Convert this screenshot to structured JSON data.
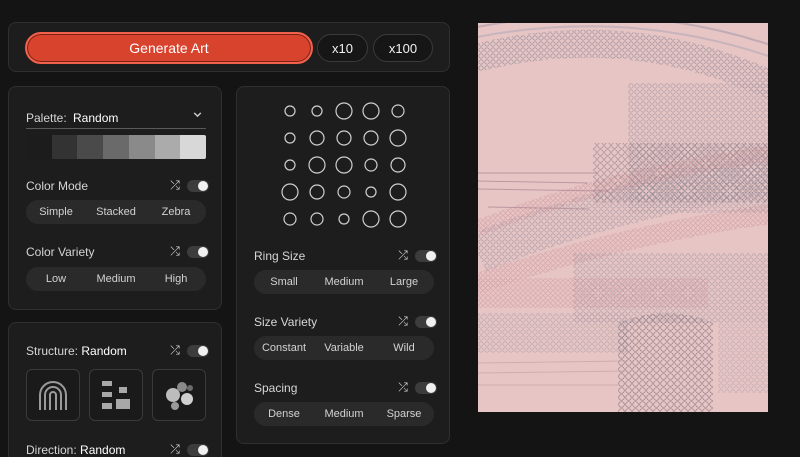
{
  "top_bar": {
    "generate_label": "Generate Art",
    "x10_label": "x10",
    "x100_label": "x100"
  },
  "color_panel": {
    "palette_label": "Palette:",
    "palette_value": "Random",
    "swatches": [
      "#1c1c1c",
      "#333333",
      "#4a4a4a",
      "#6a6a6a",
      "#8a8a8a",
      "#ababab",
      "#d8d8d8"
    ],
    "color_mode": {
      "label": "Color Mode",
      "options": [
        "Simple",
        "Stacked",
        "Zebra"
      ]
    },
    "color_variety": {
      "label": "Color Variety",
      "options": [
        "Low",
        "Medium",
        "High"
      ]
    }
  },
  "structure_panel": {
    "structure_label": "Structure:",
    "structure_value": "Random",
    "icons": [
      "arch-icon",
      "blocks-icon",
      "circles-icon"
    ],
    "direction_label": "Direction:",
    "direction_value": "Random"
  },
  "ring_panel": {
    "ring_size": {
      "label": "Ring Size",
      "options": [
        "Small",
        "Medium",
        "Large"
      ]
    },
    "size_variety": {
      "label": "Size Variety",
      "options": [
        "Constant",
        "Variable",
        "Wild"
      ]
    },
    "spacing": {
      "label": "Spacing",
      "options": [
        "Dense",
        "Medium",
        "Sparse"
      ]
    }
  },
  "colors": {
    "accent": "#d8432e",
    "artwork_background": "#e7c5c4"
  }
}
